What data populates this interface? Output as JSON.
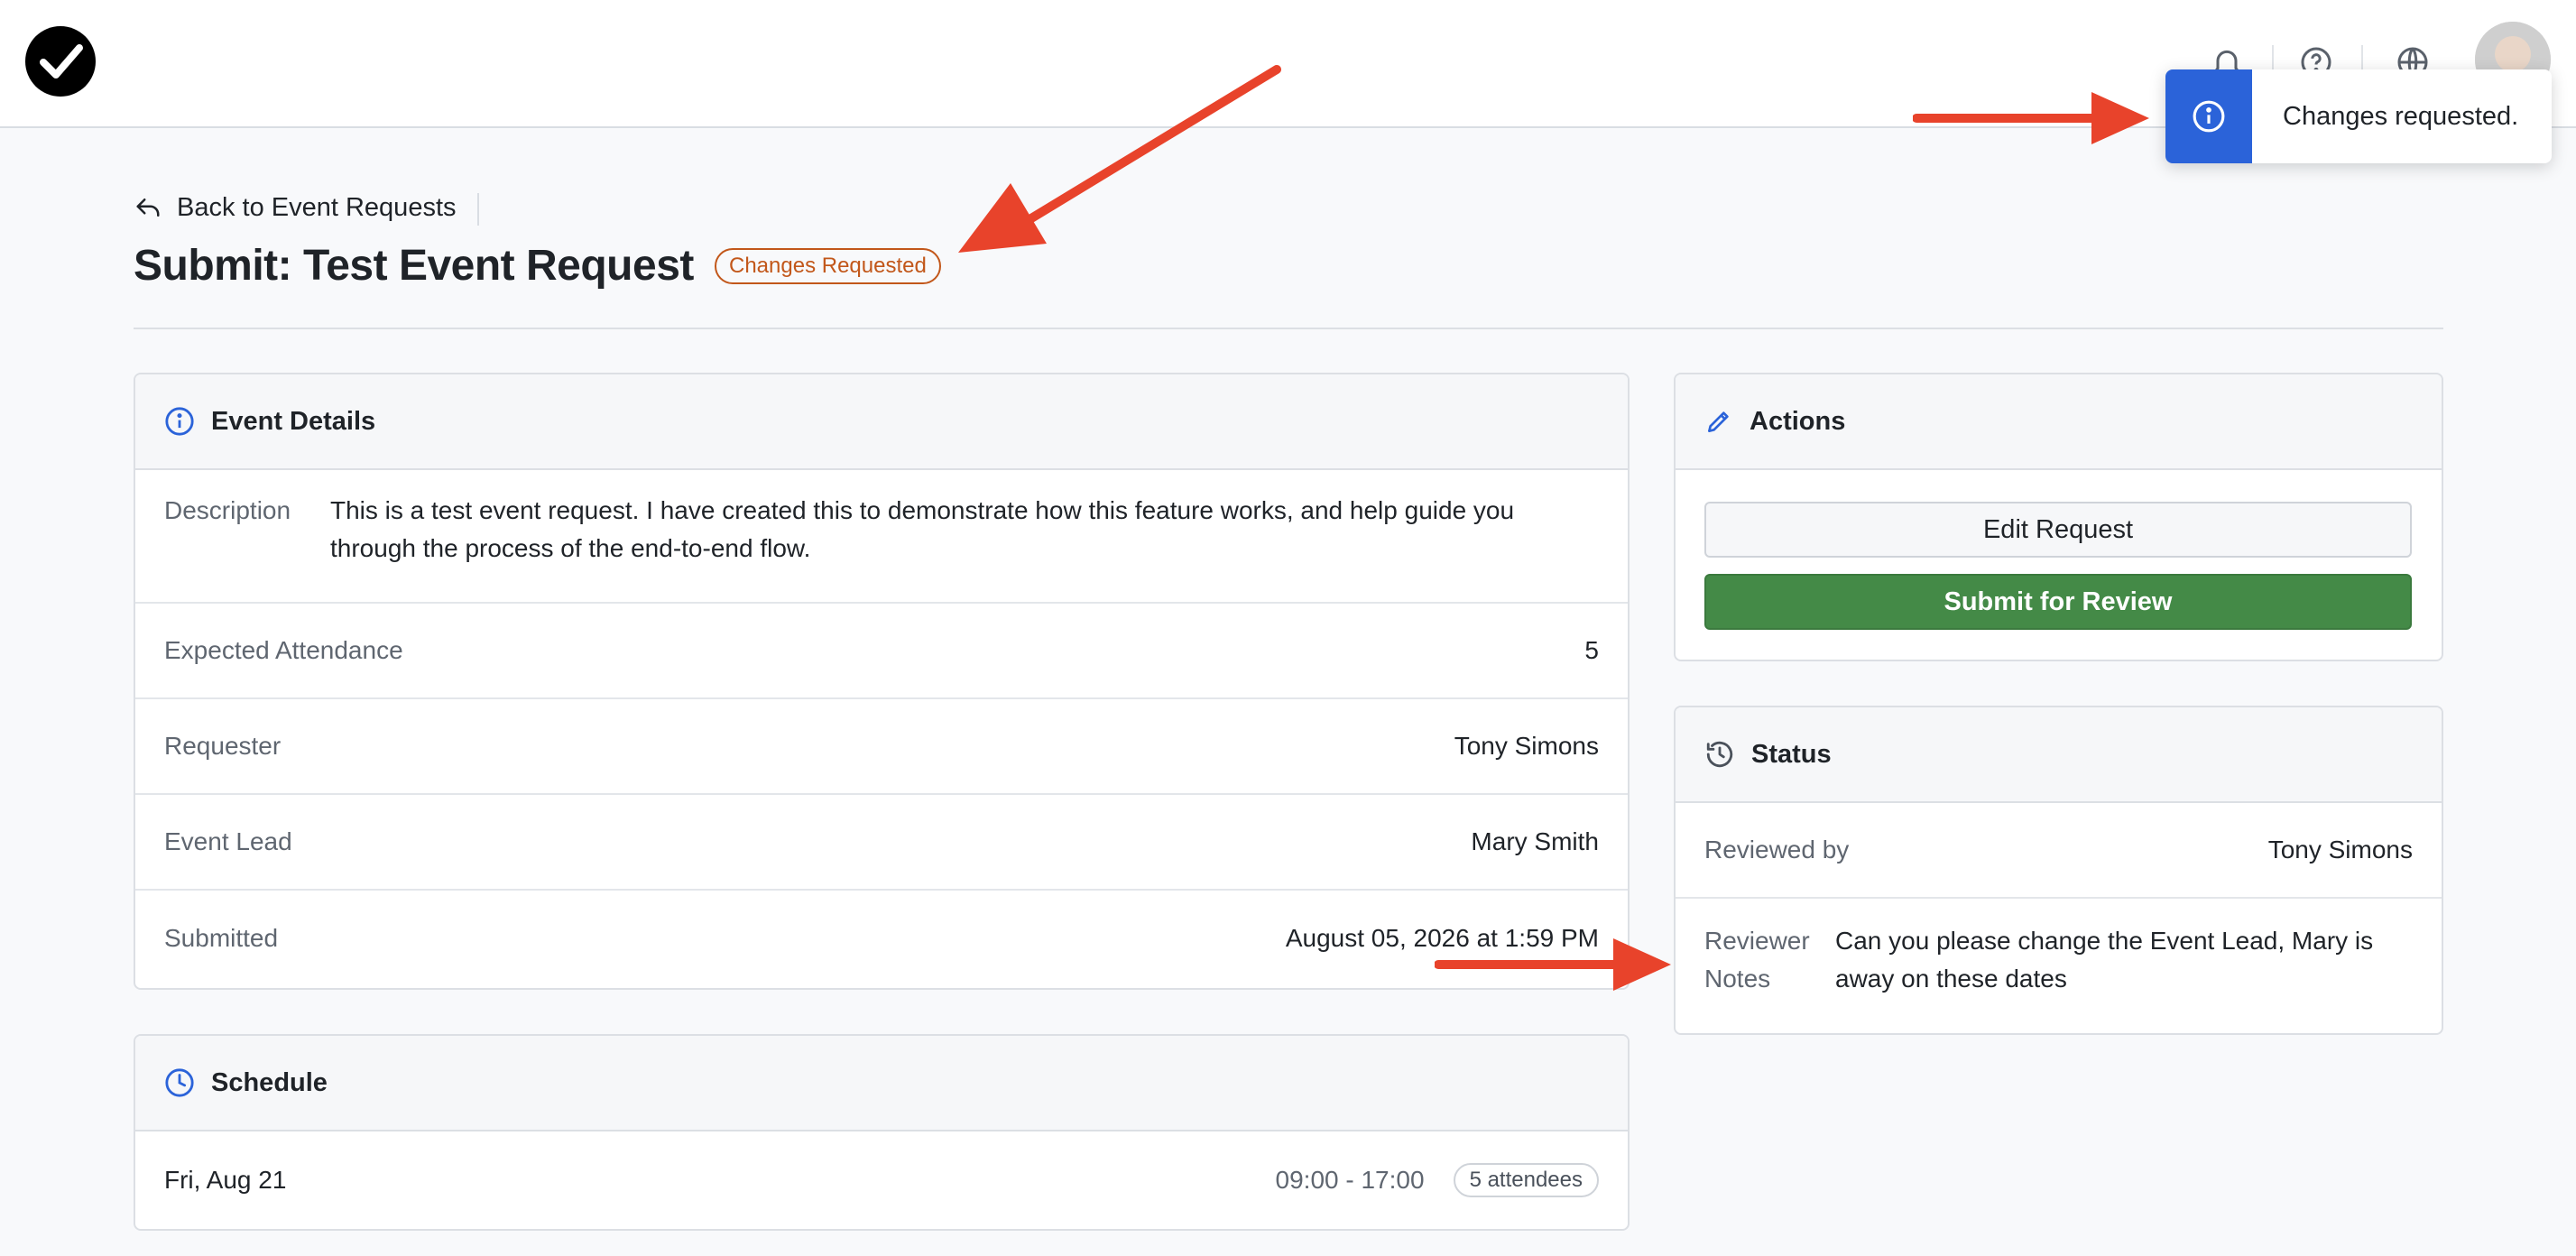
{
  "header": {
    "logo_icon": "checkmark-circle-logo",
    "icons": [
      "bell-icon",
      "help-icon",
      "globe-icon"
    ],
    "avatar": "user-avatar"
  },
  "toast": {
    "icon": "info-icon",
    "message": "Changes requested.",
    "accent": "#2b63d9"
  },
  "page": {
    "back_label": "Back to Event Requests",
    "title": "Submit: Test Event Request",
    "status_badge": "Changes Requested",
    "badge_color": "#c2571a"
  },
  "event_details": {
    "heading": "Event Details",
    "description_label": "Description",
    "description": "This is a test event request. I have created this to demonstrate how this feature works, and help guide you through the process of the end-to-end flow.",
    "fields": [
      {
        "label": "Expected Attendance",
        "value": "5"
      },
      {
        "label": "Requester",
        "value": "Tony Simons"
      },
      {
        "label": "Event Lead",
        "value": "Mary Smith"
      },
      {
        "label": "Submitted",
        "value": "August 05, 2026 at 1:59 PM"
      }
    ]
  },
  "schedule": {
    "heading": "Schedule",
    "items": [
      {
        "date": "Fri, Aug 21",
        "time": "09:00 - 17:00",
        "attendees": "5 attendees"
      }
    ]
  },
  "actions": {
    "heading": "Actions",
    "edit_label": "Edit Request",
    "submit_label": "Submit for Review",
    "primary_color": "#448a47"
  },
  "status": {
    "heading": "Status",
    "reviewed_by_label": "Reviewed by",
    "reviewed_by": "Tony Simons",
    "notes_label": "Reviewer Notes",
    "notes": "Can you please change the Event Lead, Mary is away on these dates"
  },
  "annotation_color": "#e8432b"
}
